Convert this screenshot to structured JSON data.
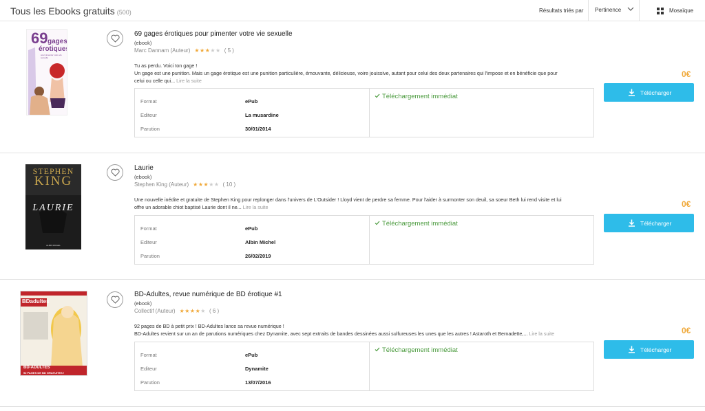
{
  "header": {
    "title": "Tous les Ebooks gratuits",
    "count": "(500)",
    "sort_label": "Résultats triés par",
    "sort_value": "Pertinence",
    "view_label": "Mosaïque"
  },
  "labels": {
    "format": "Format",
    "publisher": "Editeur",
    "date": "Parution",
    "availability": "Téléchargement immédiat",
    "download": "Télécharger",
    "read_more": "Lire la suite"
  },
  "colors": {
    "accent": "#2ebce9",
    "price": "#f0a93a",
    "available": "#4a9a3d"
  },
  "books": [
    {
      "title": "69 gages érotiques pour pimenter votre vie sexuelle",
      "type": "(ebook)",
      "author": "Marc Dannam (Auteur)",
      "rating": 3,
      "rating_count": "( 5 )",
      "desc_lines": [
        "Tu as perdu. Voici ton gage !",
        "Un gage est une punition. Mais un gage érotique est une punition particulière, émouvante, délicieuse, voire jouissive, autant pour celui des deux partenaires qui l'impose et en bénéficie que pour",
        "celui ou celle qui..."
      ],
      "format": "ePub",
      "publisher": "La musardine",
      "date": "30/01/2014",
      "price": "0€",
      "cover_text": {
        "num": "69",
        "word1": "gages",
        "word2": "érotiques",
        "sub": "pour pimenter votre vie sexuelle"
      }
    },
    {
      "title": "Laurie",
      "type": "(ebook)",
      "author": "Stephen King (Auteur)",
      "rating": 3,
      "rating_count": "( 10 )",
      "desc_lines": [
        "Une nouvelle inédite et gratuite de Stephen King pour replonger dans l'univers de L'Outsider ! Lloyd vient de perdre sa femme. Pour l'aider à surmonter son deuil, sa soeur Beth lui rend visite et lui",
        "offre un adorable chiot baptisé Laurie dont il ne..."
      ],
      "format": "ePub",
      "publisher": "Albin Michel",
      "date": "26/02/2019",
      "price": "0€",
      "cover_text": {
        "line1": "STEPHEN",
        "line2": "KING",
        "title": "LAURIE",
        "publisher": "ALBIN MICHEL"
      }
    },
    {
      "title": "BD-Adultes, revue numérique de BD érotique #1",
      "type": "(ebook)",
      "author": "Collectif (Auteur)",
      "rating": 4,
      "rating_count": "( 6 )",
      "desc_lines": [
        "92 pages de BD à petit prix ! BD-Adultes lance sa revue numérique !",
        "BD-Adultes revient sur un an de parutions numériques chez Dynamite, avec sept extraits de bandes dessinées aussi sulfureuses les unes que les autres ! Astaroth et Bernadette,..."
      ],
      "format": "ePub",
      "publisher": "Dynamite",
      "date": "13/07/2016",
      "price": "0€",
      "cover_text": {
        "brand": "BDadultes",
        "bottom": "BD-ADULTES",
        "bottom2": "92 PAGES DE BD GRATUITES !"
      }
    }
  ]
}
